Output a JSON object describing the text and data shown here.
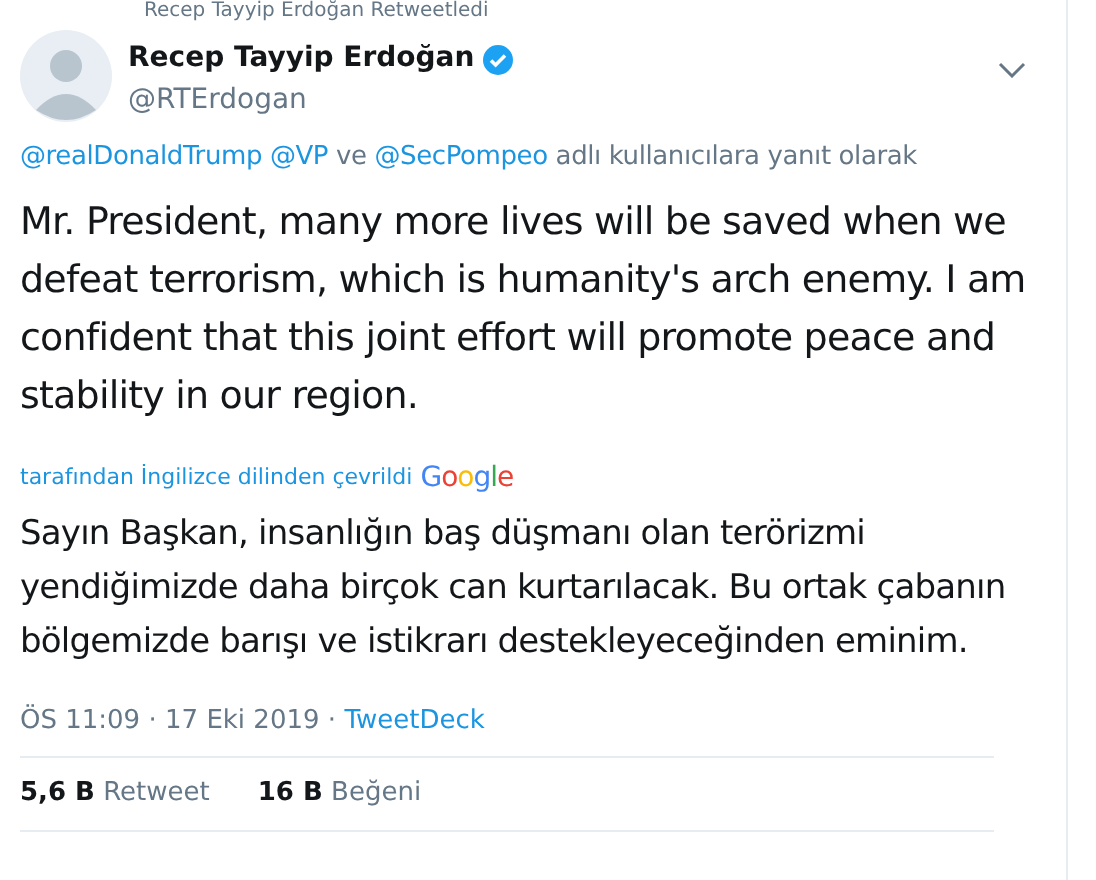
{
  "retweet_context": "Recep Tayyip Erdoğan Retweetledi",
  "author": {
    "name": "Recep Tayyip Erdoğan",
    "verified": true,
    "handle": "@RTErdogan"
  },
  "reply_to": [
    {
      "text": "@realDonaldTrump",
      "kind": "link"
    },
    {
      "text": "@VP",
      "kind": "link"
    },
    {
      "text": "ve",
      "kind": "plain"
    },
    {
      "text": "@SecPompeo",
      "kind": "link"
    },
    {
      "text": "adlı kullanıcılara yanıt olarak",
      "kind": "plain"
    }
  ],
  "tweet_text": "Mr. President, many more lives will be saved when we defeat terrorism, which is humanity's arch enemy. I am confident that this joint effort will promote peace and stability in our region.",
  "translation": {
    "label": "tarafından İngilizce dilinden çevrildi",
    "logo": "Google",
    "text": "Sayın Başkan, insanlığın baş düşmanı olan terörizmi yendiğimizde daha birçok can kurtarılacak. Bu ortak çabanın bölgemizde barışı ve istikrarı destekleyeceğinden eminim."
  },
  "meta": [
    {
      "text": "ÖS 11:09",
      "kind": "plain"
    },
    {
      "text": "·",
      "kind": "plain"
    },
    {
      "text": "17 Eki 2019",
      "kind": "plain"
    },
    {
      "text": "·",
      "kind": "plain"
    },
    {
      "text": "TweetDeck",
      "kind": "link"
    }
  ],
  "stats": [
    {
      "count": "5,6 B",
      "label": "Retweet"
    },
    {
      "count": "16 B",
      "label": "Beğeni"
    }
  ]
}
